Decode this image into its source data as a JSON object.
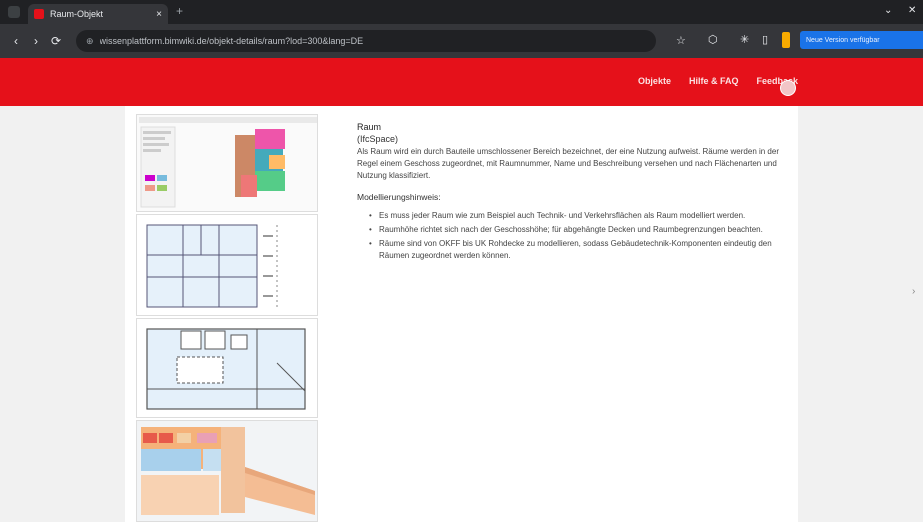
{
  "browser": {
    "tab_title": "Raum-Objekt",
    "tab_close": "×",
    "new_tab": "+",
    "minimize": "⌄",
    "close": "✕",
    "back": "‹",
    "forward": "›",
    "reload": "⟳",
    "url": "wissenplattform.bimwiki.de/objekt-details/raum?lod=300&lang=DE",
    "url_icon": "⊕",
    "profile_label": "Neue Version verfügbar",
    "star_icon": "☆",
    "extension_icons": [
      "⬡",
      "✳",
      "▯"
    ]
  },
  "site_header": {
    "nav": [
      "Objekte",
      "Hilfe & FAQ",
      "Feedback"
    ],
    "brand_color": "#e5111a"
  },
  "content": {
    "title": "Raum",
    "subtitle": "(IfcSpace)",
    "paragraph": "Als Raum wird ein durch Bauteile umschlossener Bereich bezeichnet, der eine Nutzung aufweist. Räume werden in der Regel einem Geschoss zugeordnet, mit Raumnummer, Name und Beschreibung versehen und nach Flächenarten und Nutzung klassifiziert.",
    "heading": "Modellierungshinweis:",
    "bullets": [
      "Es muss jeder Raum wie zum Beispiel auch Technik- und Verkehrsflächen als Raum modelliert werden.",
      "Raumhöhe richtet sich nach der Geschosshöhe; für abgehängte Decken und Raumbegrenzungen beachten.",
      "Räume sind von OKFF bis UK Rohdecke zu modellieren, sodass Gebäudetechnik-Komponenten eindeutig den Räumen zugeordnet werden können."
    ]
  },
  "side_handle": "›"
}
